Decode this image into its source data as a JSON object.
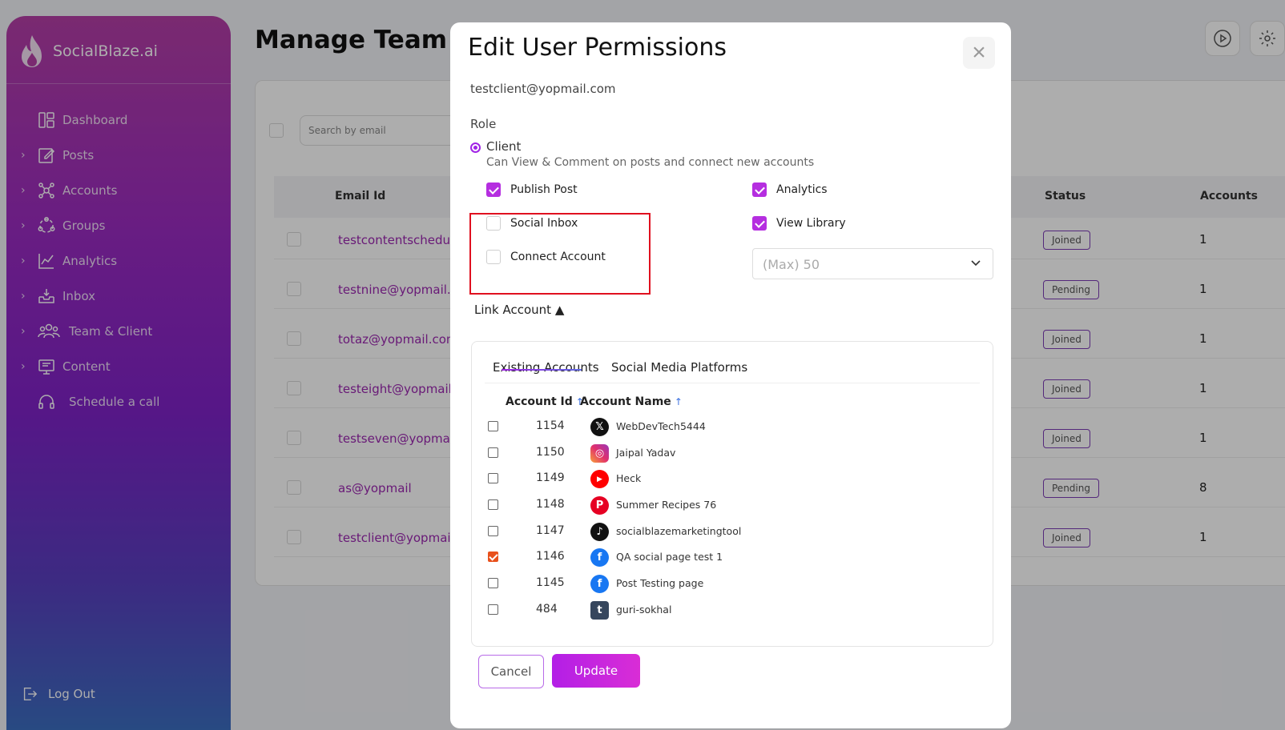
{
  "brand": {
    "name": "SocialBlaze.ai"
  },
  "sidebar": {
    "items": [
      {
        "label": "Dashboard",
        "icon": "dashboard-icon",
        "chevron": false
      },
      {
        "label": "Posts",
        "icon": "edit-icon",
        "chevron": true
      },
      {
        "label": "Accounts",
        "icon": "network-icon",
        "chevron": true
      },
      {
        "label": "Groups",
        "icon": "groups-icon",
        "chevron": true
      },
      {
        "label": "Analytics",
        "icon": "chart-icon",
        "chevron": true
      },
      {
        "label": "Inbox",
        "icon": "inbox-icon",
        "chevron": true
      },
      {
        "label": "Team & Client",
        "icon": "team-icon",
        "chevron": true
      },
      {
        "label": "Content",
        "icon": "content-icon",
        "chevron": true
      },
      {
        "label": "Schedule a call",
        "icon": "headset-icon",
        "chevron": false
      }
    ],
    "logout": "Log Out"
  },
  "page": {
    "title": "Manage Team &",
    "search_placeholder": "Search by email",
    "columns": {
      "email": "Email Id",
      "status": "Status",
      "accounts": "Accounts"
    },
    "rows": [
      {
        "email": "testcontentschedule",
        "status": "Joined",
        "accounts": "1"
      },
      {
        "email": "testnine@yopmail.c",
        "status": "Pending",
        "accounts": "1"
      },
      {
        "email": "totaz@yopmail.com",
        "status": "Joined",
        "accounts": "1"
      },
      {
        "email": "testeight@yopmail.c",
        "status": "Joined",
        "accounts": "1"
      },
      {
        "email": "testseven@yopmail",
        "status": "Joined",
        "accounts": "1"
      },
      {
        "email": "as@yopmail",
        "status": "Pending",
        "accounts": "8"
      },
      {
        "email": "testclient@yopmail.",
        "status": "Joined",
        "accounts": "1"
      }
    ]
  },
  "modal": {
    "title": "Edit User Permissions",
    "close": "×",
    "user_email": "testclient@yopmail.com",
    "role_label": "Role",
    "role_name": "Client",
    "role_desc": "Can View & Comment on posts and connect new accounts",
    "permissions": {
      "publish_post": {
        "label": "Publish Post",
        "checked": true
      },
      "analytics": {
        "label": "Analytics",
        "checked": true
      },
      "social_inbox": {
        "label": "Social Inbox",
        "checked": false
      },
      "view_library": {
        "label": "View Library",
        "checked": true
      },
      "connect_account": {
        "label": "Connect Account",
        "checked": false
      }
    },
    "library_limit": "(Max) 50",
    "link_account": "Link Account ▲",
    "tabs": [
      "Existing Accounts",
      "Social Media Platforms"
    ],
    "columns": {
      "id": "Account Id",
      "name": "Account Name",
      "sort_arrow": "↑"
    },
    "accounts": [
      {
        "id": "1154",
        "name": "WebDevTech5444",
        "platform": "x",
        "checked": false
      },
      {
        "id": "1150",
        "name": "Jaipal Yadav",
        "platform": "instagram",
        "checked": false
      },
      {
        "id": "1149",
        "name": "Heck",
        "platform": "youtube",
        "checked": false
      },
      {
        "id": "1148",
        "name": "Summer Recipes 76",
        "platform": "pinterest",
        "checked": false
      },
      {
        "id": "1147",
        "name": "socialblazemarketingtool",
        "platform": "tiktok",
        "checked": false
      },
      {
        "id": "1146",
        "name": "QA social page test 1",
        "platform": "facebook",
        "checked": true
      },
      {
        "id": "1145",
        "name": "Post Testing page",
        "platform": "facebook",
        "checked": false
      },
      {
        "id": "484",
        "name": "guri-sokhal",
        "platform": "tumblr",
        "checked": false
      }
    ],
    "cancel": "Cancel",
    "update": "Update"
  },
  "colors": {
    "accent": "#b52ee0",
    "highlight": "#e0101f",
    "checked_row": "#e8511c"
  }
}
